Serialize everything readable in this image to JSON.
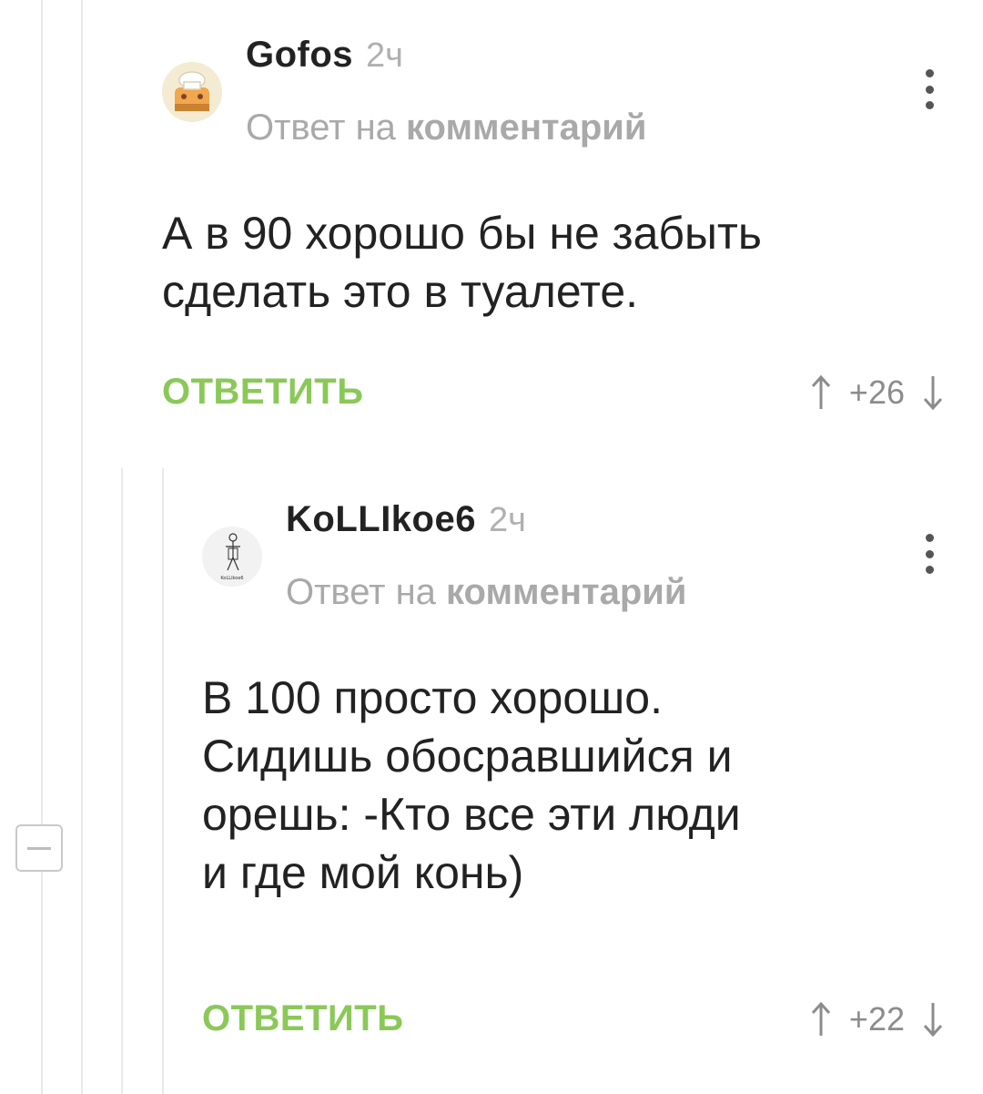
{
  "comments": [
    {
      "author": "Gofos",
      "time": "2ч",
      "reply_prefix": "Ответ на",
      "reply_link": "комментарий",
      "text_lines": [
        "А в 90 хорошо бы не забыть",
        "сделать это в туалете."
      ],
      "reply_button": "ОТВЕТИТЬ",
      "rating": "+26",
      "avatar_icon": "chef-hat-toaster-icon"
    },
    {
      "author": "KoLLIkoe6",
      "time": "2ч",
      "reply_prefix": "Ответ на",
      "reply_link": "комментарий",
      "text_lines": [
        "В 100 просто хорошо.",
        "Сидишь обосравшийся и",
        "орешь: -Кто все эти люди",
        "и где мой конь)"
      ],
      "reply_button": "ОТВЕТИТЬ",
      "rating": "+22",
      "avatar_icon": "sketch-figure-icon",
      "avatar_caption": "KoLLIkoe6"
    }
  ],
  "colors": {
    "accent_green": "#8ac858",
    "text": "#222222",
    "muted": "#a9a9a9",
    "thread_line": "#e9e9e9"
  }
}
